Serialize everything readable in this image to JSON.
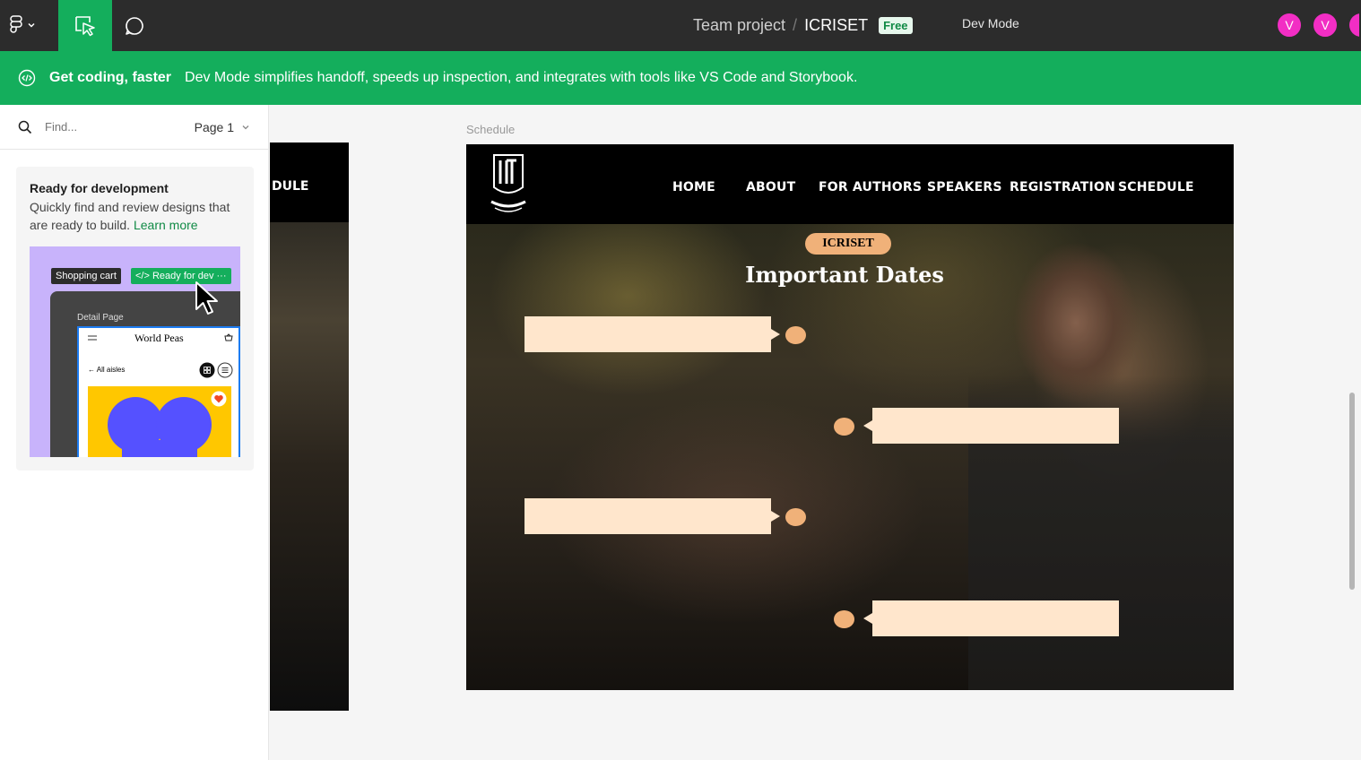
{
  "toolbar": {
    "team": "Team project",
    "separator": "/",
    "file": "ICRISET",
    "plan_badge": "Free",
    "dev_mode_label": "Dev Mode",
    "avatars": [
      "V",
      "V"
    ]
  },
  "banner": {
    "title": "Get coding, faster",
    "text": "Dev Mode simplifies handoff, speeds up inspection, and integrates with tools like VS Code and Storybook."
  },
  "left_panel": {
    "search_placeholder": "Find...",
    "page_selector": "Page 1",
    "card": {
      "title": "Ready for development",
      "description": "Quickly find and review designs that are ready to build.",
      "link": "Learn more",
      "illustration": {
        "chip_dark": "Shopping cart",
        "chip_green": "</> Ready for dev ···",
        "detail_label": "Detail Page",
        "brand": "World Peas",
        "aisles": "← All aisles"
      }
    }
  },
  "canvas": {
    "prev_frame_label": "DULE",
    "frame_label": "Schedule",
    "site": {
      "nav": [
        "HOME",
        "ABOUT",
        "FOR  AUTHORS",
        "SPEAKERS",
        "REGISTRATION",
        "SCHEDULE"
      ],
      "badge": "ICRISET",
      "heading": "Important Dates"
    }
  },
  "colors": {
    "toolbar_bg": "#2c2c2c",
    "accent_green": "#14ae5c",
    "avatar": "#f22ec4",
    "timeline_box": "#ffe6cc",
    "timeline_dot": "#f0b179"
  }
}
